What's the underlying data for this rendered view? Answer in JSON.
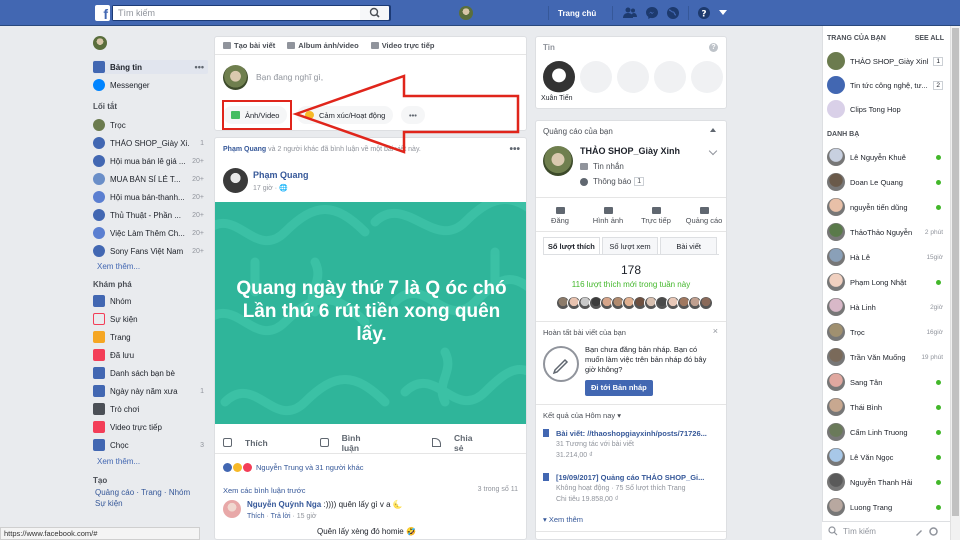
{
  "topbar": {
    "logo": "f",
    "search_placeholder": "Tìm kiếm",
    "home": "Trang chủ",
    "home_count": "1"
  },
  "left_nav": {
    "feed": "Bảng tin",
    "messenger": "Messenger",
    "shortcuts_title": "Lối tắt",
    "shortcuts": [
      {
        "label": "Trọc",
        "count": ""
      },
      {
        "label": "THẢO SHOP_Giày Xi...",
        "count": "1"
      },
      {
        "label": "Hội mua bán lê giá ...",
        "count": "20+"
      },
      {
        "label": "MUA BÁN SỈ LẺ T...",
        "count": "20+"
      },
      {
        "label": "Hội mua bán-thanh...",
        "count": "20+"
      },
      {
        "label": "Thủ Thuật - Phần ...",
        "count": "20+"
      },
      {
        "label": "Việc Làm Thêm Ch...",
        "count": "20+"
      },
      {
        "label": "Sony Fans Việt Nam",
        "count": "20+"
      }
    ],
    "see_more": "Xem thêm...",
    "explore_title": "Khám phá",
    "explore": [
      {
        "label": "Nhóm",
        "count": ""
      },
      {
        "label": "Sự kiện",
        "count": ""
      },
      {
        "label": "Trang",
        "count": ""
      },
      {
        "label": "Đã lưu",
        "count": ""
      },
      {
        "label": "Danh sách bạn bè",
        "count": ""
      },
      {
        "label": "Ngày này năm xưa",
        "count": "1"
      },
      {
        "label": "Trò chơi",
        "count": ""
      },
      {
        "label": "Video trực tiếp",
        "count": ""
      },
      {
        "label": "Chọc",
        "count": "3"
      }
    ],
    "see_more2": "Xem thêm...",
    "create_title": "Tạo",
    "create_links": "Quảng cáo · Trang · Nhóm",
    "create_event": "Sự kiện"
  },
  "composer": {
    "tab_create": "Tạo bài viết",
    "tab_album": "Album ảnh/video",
    "tab_live": "Video trực tiếp",
    "placeholder": "Bạn đang nghĩ gì,",
    "btn_photo": "Ảnh/Video",
    "btn_feeling": "Cảm xúc/Hoạt động",
    "btn_more": "•••"
  },
  "post": {
    "header_name": "Phạm Quang",
    "header_rest": "và 2 người khác đã bình luận về một bài viết này.",
    "author": "Phạm Quang",
    "time": "17 giờ · 🌐",
    "text_line1": "Quang ngày thứ 7 là Q óc chó",
    "text_line2": "Lần thứ 6 rút tiền xong quên",
    "text_line3": "lấy.",
    "like": "Thích",
    "comment": "Bình luận",
    "share": "Chia sẻ",
    "reactions": "Nguyễn Trung và 31 người khác",
    "see_prev": "Xem các bình luận trước",
    "comment_count": "3 trong số 11",
    "c1_name": "Nguyễn Quỳnh Nga",
    "c1_text": ":)))) quên lấy gì v a 🌜",
    "c1_like": "Thích",
    "c1_reply": "Trả lời",
    "c1_time": "· 15 giờ",
    "c2_text": "Quên lấy xèng đó homie 🤣"
  },
  "stories": {
    "title": "Tin",
    "owner": "Xuân Tiến"
  },
  "ads": {
    "title": "Quảng cáo của bạn",
    "page_name": "THẢO SHOP_Giày Xinh",
    "messages": "Tin nhắn",
    "notifications": "Thông báo",
    "notif_count": "1",
    "actions": [
      "Đăng",
      "Hình ảnh",
      "Trực tiếp",
      "Quảng cáo"
    ],
    "tabs": [
      "Số lượt thích",
      "Số lượt xem",
      "Bài viết"
    ],
    "likes_total": "178",
    "likes_new": "116 lượt thích mới trong tuần này",
    "draft_title": "Hoàn tất bài viết của bạn",
    "draft_text": "Bạn chưa đăng bản nháp. Bạn có muốn làm việc trên bản nháp đó bây giờ không?",
    "draft_btn": "Đi tới Bản nháp",
    "results_title": "Kết quả của Hôm nay ▾",
    "r1_title": "Bài viết: //thaoshopgiayxinh/posts/71726...",
    "r1_line1": "31 Tương tác với bài viết",
    "r1_line2": "31.214,00 ₫",
    "r2_title": "[19/09/2017] Quảng cáo THẢO SHOP_Gi...",
    "r2_line1": "Không hoạt động · 75 Số lượt thích Trang",
    "r2_line2": "Chi tiêu 19.858,00 ₫",
    "see_more": "Xem thêm"
  },
  "right_sidebar": {
    "pages_title": "TRANG CỦA BẠN",
    "see_all": "SEE ALL",
    "pages": [
      {
        "name": "THẢO SHOP_Giày Xinh",
        "badge": "1"
      },
      {
        "name": "Tin tức công nghệ, tư...",
        "badge": "2"
      },
      {
        "name": "Clips Tong Hop",
        "badge": ""
      }
    ],
    "contacts_title": "DANH BẠ",
    "contacts": [
      {
        "name": "Lê Nguyễn Khuê",
        "status": "online"
      },
      {
        "name": "Doan Le Quang",
        "status": "online"
      },
      {
        "name": "nguyễn tiến dũng",
        "status": "online"
      },
      {
        "name": "ThảoThảo Nguyễn",
        "status": "2 phút"
      },
      {
        "name": "Hà Lê",
        "status": "15giờ"
      },
      {
        "name": "Phạm Long Nhật",
        "status": "online"
      },
      {
        "name": "Hà Linh",
        "status": "2giờ"
      },
      {
        "name": "Trọc",
        "status": "16giờ"
      },
      {
        "name": "Trần Văn Muống",
        "status": "19 phút"
      },
      {
        "name": "Sang Tân",
        "status": "online"
      },
      {
        "name": "Thái Bình",
        "status": "online"
      },
      {
        "name": "Cẩm Linh Truong",
        "status": "online"
      },
      {
        "name": "Lê Văn Ngọc",
        "status": "online"
      },
      {
        "name": "Nguyễn Thanh Hải",
        "status": "online"
      },
      {
        "name": "Luong Trang",
        "status": "online"
      }
    ],
    "search_placeholder": "Tìm kiếm"
  },
  "statusbar": "https://www.facebook.com/#",
  "colors": {
    "brand": "#4267b2",
    "link": "#365899",
    "highlight_red": "#e0251b",
    "post_bg": "#2fb59a",
    "online": "#42b72a"
  }
}
